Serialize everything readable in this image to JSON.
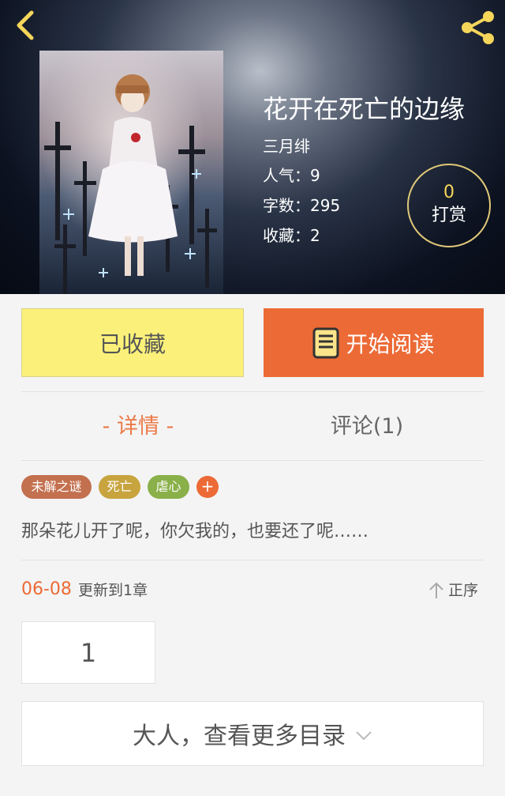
{
  "header": {
    "back_icon": "chevron-left-icon",
    "share_icon": "share-icon",
    "accent": "#f5d65a"
  },
  "book": {
    "title": "花开在死亡的边缘",
    "author": "三月绯",
    "popularity": "人气：9",
    "word_count": "字数：295",
    "favorites": "收藏：2"
  },
  "tip": {
    "count": "0",
    "label": "打赏"
  },
  "actions": {
    "favorited_label": "已收藏",
    "read_label": "开始阅读",
    "read_color": "#ec6a36",
    "favorited_color": "#fbf17a"
  },
  "tabs": {
    "detail": "- 详情 -",
    "comments": "评论(1)"
  },
  "tags": [
    {
      "label": "未解之谜",
      "color": "#c3704f"
    },
    {
      "label": "死亡",
      "color": "#c8a43f"
    },
    {
      "label": "虐心",
      "color": "#8ab04a"
    }
  ],
  "tag_add": "+",
  "intro": "那朵花儿开了呢，你欠我的，也要还了呢……",
  "update": {
    "date": "06-08",
    "text": "更新到1章"
  },
  "sort": {
    "label": "正序",
    "icon": "arrow-up-icon"
  },
  "chapters": [
    "1"
  ],
  "more_catalog": "大人，查看更多目录"
}
